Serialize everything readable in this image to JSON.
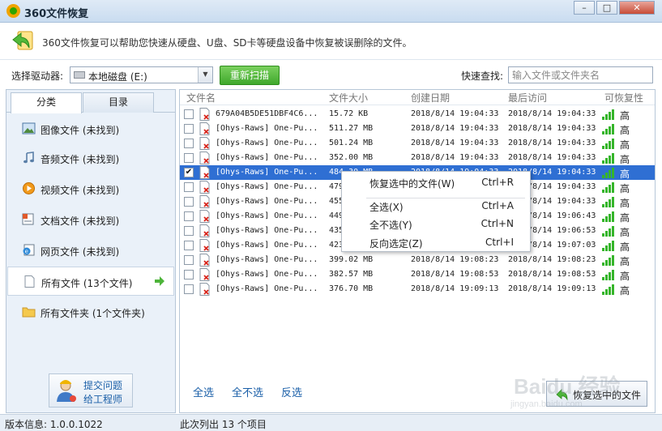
{
  "window": {
    "title": "360文件恢复",
    "controls": [
      "minimize",
      "maximize",
      "close"
    ]
  },
  "info": {
    "description": "360文件恢复可以帮助您快速从硬盘、U盘、SD卡等硬盘设备中恢复被误删除的文件。"
  },
  "toolbar": {
    "drive_label": "选择驱动器:",
    "drive_value": "本地磁盘 (E:)",
    "scan_label": "重新扫描",
    "search_label": "快速查找:",
    "search_placeholder": "输入文件或文件夹名"
  },
  "left": {
    "tabs": [
      {
        "label": "分类"
      },
      {
        "label": "目录"
      }
    ],
    "categories": [
      {
        "label": "图像文件 (未找到)",
        "icon": "image-icon"
      },
      {
        "label": "音频文件 (未找到)",
        "icon": "music-icon"
      },
      {
        "label": "视频文件 (未找到)",
        "icon": "video-icon"
      },
      {
        "label": "文档文件 (未找到)",
        "icon": "document-icon"
      },
      {
        "label": "网页文件 (未找到)",
        "icon": "webpage-icon"
      },
      {
        "label": "所有文件 (13个文件)",
        "icon": "file-icon"
      },
      {
        "label": "所有文件夹 (1个文件夹)",
        "icon": "folder-icon"
      }
    ],
    "help": {
      "line1": "提交问题",
      "line2": "给工程师"
    }
  },
  "table": {
    "columns": [
      "文件名",
      "文件大小",
      "创建日期",
      "最后访问",
      "可恢复性"
    ],
    "rows": [
      {
        "checked": false,
        "name": "679A04B5DE51DBF4C6...",
        "size": "15.72 KB",
        "created": "2018/8/14 19:04:33",
        "accessed": "2018/8/14 19:04:33",
        "quality": "高"
      },
      {
        "checked": false,
        "name": "[Ohys-Raws] One-Pu...",
        "size": "511.27 MB",
        "created": "2018/8/14 19:04:33",
        "accessed": "2018/8/14 19:04:33",
        "quality": "高"
      },
      {
        "checked": false,
        "name": "[Ohys-Raws] One-Pu...",
        "size": "501.24 MB",
        "created": "2018/8/14 19:04:33",
        "accessed": "2018/8/14 19:04:33",
        "quality": "高"
      },
      {
        "checked": false,
        "name": "[Ohys-Raws] One-Pu...",
        "size": "352.00 MB",
        "created": "2018/8/14 19:04:33",
        "accessed": "2018/8/14 19:04:33",
        "quality": "高"
      },
      {
        "checked": true,
        "name": "[Ohys-Raws] One-Pu...",
        "size": "484.30 MB",
        "created": "2018/8/14 19:04:33",
        "accessed": "2018/8/14 19:04:33",
        "quality": "高"
      },
      {
        "checked": false,
        "name": "[Ohys-Raws] One-Pu...",
        "size": "479",
        "created": "",
        "accessed": "2018/8/14 19:04:33",
        "quality": "高"
      },
      {
        "checked": false,
        "name": "[Ohys-Raws] One-Pu...",
        "size": "455",
        "created": "",
        "accessed": "2018/8/14 19:04:33",
        "quality": "高"
      },
      {
        "checked": false,
        "name": "[Ohys-Raws] One-Pu...",
        "size": "449",
        "created": "",
        "accessed": "2018/8/14 19:06:43",
        "quality": "高"
      },
      {
        "checked": false,
        "name": "[Ohys-Raws] One-Pu...",
        "size": "435",
        "created": "",
        "accessed": "2018/8/14 19:06:53",
        "quality": "高"
      },
      {
        "checked": false,
        "name": "[Ohys-Raws] One-Pu...",
        "size": "423",
        "created": "",
        "accessed": "2018/8/14 19:07:03",
        "quality": "高"
      },
      {
        "checked": false,
        "name": "[Ohys-Raws] One-Pu...",
        "size": "399.02 MB",
        "created": "2018/8/14 19:08:23",
        "accessed": "2018/8/14 19:08:23",
        "quality": "高"
      },
      {
        "checked": false,
        "name": "[Ohys-Raws] One-Pu...",
        "size": "382.57 MB",
        "created": "2018/8/14 19:08:53",
        "accessed": "2018/8/14 19:08:53",
        "quality": "高"
      },
      {
        "checked": false,
        "name": "[Ohys-Raws] One-Pu...",
        "size": "376.70 MB",
        "created": "2018/8/14 19:09:13",
        "accessed": "2018/8/14 19:09:13",
        "quality": "高"
      }
    ]
  },
  "context_menu": {
    "items": [
      {
        "label": "恢复选中的文件(W)",
        "shortcut": "Ctrl+R"
      },
      {
        "label": "全选(X)",
        "shortcut": "Ctrl+A"
      },
      {
        "label": "全不选(Y)",
        "shortcut": "Ctrl+N"
      },
      {
        "label": "反向选定(Z)",
        "shortcut": "Ctrl+I"
      }
    ]
  },
  "bottom": {
    "select_all": "全选",
    "select_none": "全不选",
    "invert": "反选",
    "recover_button": "恢复选中的文件"
  },
  "status": {
    "version": "版本信息: 1.0.0.1022",
    "listing": "此次列出 13 个项目"
  },
  "watermark": {
    "text": "Baidu 经验",
    "url": "jingyan.baidu.com"
  },
  "colors": {
    "accent_green": "#3fa82c",
    "selection_blue": "#2f6fd3",
    "link_blue": "#1a5fa8"
  }
}
